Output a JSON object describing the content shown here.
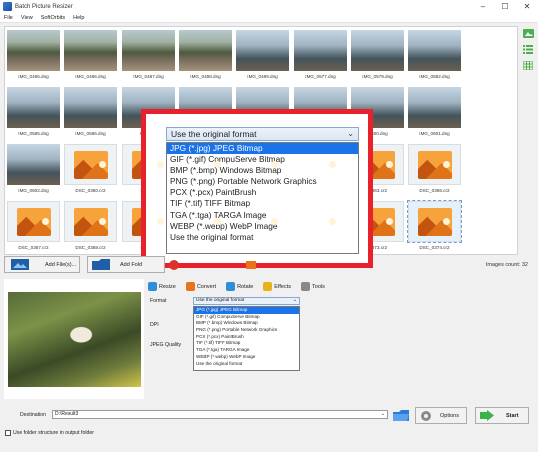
{
  "window": {
    "title": "Batch Picture Resizer",
    "controls": [
      "–",
      "☐",
      "✕"
    ]
  },
  "menu": [
    "File",
    "View",
    "SoftOrbits",
    "Help"
  ],
  "thumbnails": [
    {
      "name": "IMG_0485.dng",
      "kind": "photo-trees"
    },
    {
      "name": "IMG_0486.dng",
      "kind": "photo-trees"
    },
    {
      "name": "IMG_0487.dng",
      "kind": "photo-trees"
    },
    {
      "name": "IMG_0488.dng",
      "kind": "photo-trees"
    },
    {
      "name": "IMG_0489.dng",
      "kind": "photo"
    },
    {
      "name": "IMG_0577.dng",
      "kind": "photo"
    },
    {
      "name": "IMG_0579.dng",
      "kind": "photo"
    },
    {
      "name": "IMG_0582.dng",
      "kind": "photo"
    },
    {
      "name": "IMG_0585.dng",
      "kind": "photo"
    },
    {
      "name": "IMG_0586.dng",
      "kind": "photo"
    },
    {
      "name": "IMG_0...",
      "kind": "photo"
    },
    {
      "name": "",
      "kind": "photo"
    },
    {
      "name": "",
      "kind": "photo"
    },
    {
      "name": "",
      "kind": "photo"
    },
    {
      "name": "...600.dng",
      "kind": "photo"
    },
    {
      "name": "IMG_0601.dng",
      "kind": "photo"
    },
    {
      "name": "IMG_0602.dng",
      "kind": "photo"
    },
    {
      "name": "DSC_0360.cr2",
      "kind": "raw"
    },
    {
      "name": "DSC_...",
      "kind": "raw"
    },
    {
      "name": "",
      "kind": "raw"
    },
    {
      "name": "",
      "kind": "raw"
    },
    {
      "name": "",
      "kind": "raw"
    },
    {
      "name": "...363.cr2",
      "kind": "raw"
    },
    {
      "name": "DSC_0366.cr2",
      "kind": "raw"
    },
    {
      "name": "DSC_0367.cr2",
      "kind": "raw"
    },
    {
      "name": "DSC_0368.cr2",
      "kind": "raw"
    },
    {
      "name": "DSC_...",
      "kind": "raw"
    },
    {
      "name": "",
      "kind": "raw"
    },
    {
      "name": "",
      "kind": "raw"
    },
    {
      "name": "",
      "kind": "raw"
    },
    {
      "name": "...373.cr2",
      "kind": "raw"
    },
    {
      "name": "DSC_0374.cr2",
      "kind": "raw-selected"
    }
  ],
  "format_dropdown": {
    "selected": "Use the original format",
    "options": [
      "JPG (*.jpg) JPEG Bitmap",
      "GIF (*.gif) CompuServe Bitmap",
      "BMP (*.bmp) Windows Bitmap",
      "PNG (*.png) Portable Network Graphics",
      "PCX (*.pcx) PaintBrush",
      "TIF (*.tif) TIFF Bitmap",
      "TGA (*.tga) TARGA Image",
      "WEBP (*.webp) WebP Image",
      "Use the original format"
    ],
    "highlighted_index": 0
  },
  "toolbar": {
    "add_files": "Add File(s)...",
    "add_folder": "Add Fold",
    "images_count": "Images count: 32"
  },
  "tabs": [
    {
      "label": "Resize",
      "color": "#2d8fd5"
    },
    {
      "label": "Convert",
      "color": "#e8731a"
    },
    {
      "label": "Rotate",
      "color": "#2d8fd5"
    },
    {
      "label": "Effects",
      "color": "#e8b21a"
    },
    {
      "label": "Tools",
      "color": "#888888"
    }
  ],
  "convert_form": {
    "format_label": "Format",
    "dpi_label": "DPI",
    "jpeg_quality_label": "JPEG Quality"
  },
  "destination": {
    "label": "Destination",
    "value": "D:\\Result3",
    "options_label": "Options",
    "start_label": "Start",
    "checkbox_label": "Use folder structure in output folder",
    "checkbox_checked": false
  }
}
